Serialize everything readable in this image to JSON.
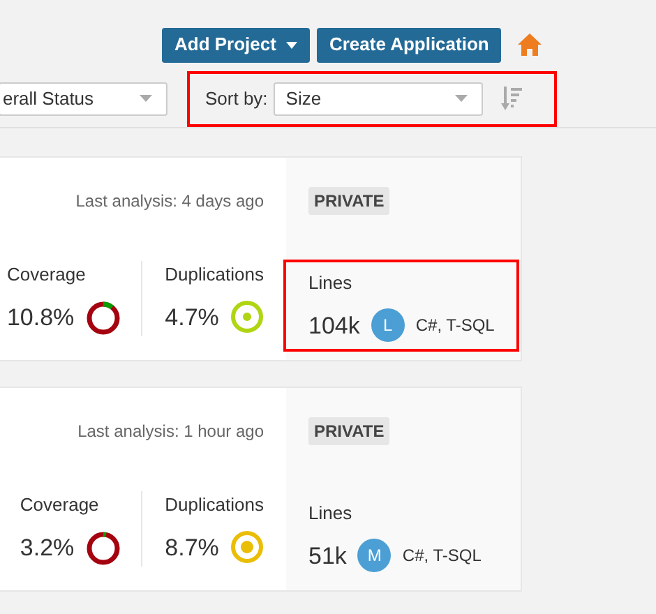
{
  "header": {
    "buttons": [
      {
        "label": "Add Project",
        "kind": "dropdown"
      },
      {
        "label": "Create Application",
        "kind": "plain"
      }
    ]
  },
  "filters": {
    "status_select": {
      "value": "erall Status"
    },
    "sort": {
      "label": "Sort by:",
      "value": "Size",
      "highlighted": true
    }
  },
  "projects": [
    {
      "last_analysis": "Last analysis: 4 days ago",
      "visibility": "PRIVATE",
      "coverage": {
        "label": "Coverage",
        "value": "10.8%",
        "level": 0.108
      },
      "duplications": {
        "label": "Duplications",
        "value": "4.7%",
        "color": "#b0d513"
      },
      "lines": {
        "label": "Lines",
        "value": "104k",
        "size_letter": "L",
        "languages": "C#, T-SQL",
        "highlighted": true
      }
    },
    {
      "last_analysis": "Last analysis: 1 hour ago",
      "visibility": "PRIVATE",
      "coverage": {
        "label": "Coverage",
        "value": "3.2%",
        "level": 0.032
      },
      "duplications": {
        "label": "Duplications",
        "value": "8.7%",
        "color": "#eabe06"
      },
      "lines": {
        "label": "Lines",
        "value": "51k",
        "size_letter": "M",
        "languages": "C#, T-SQL",
        "highlighted": false
      }
    }
  ]
}
